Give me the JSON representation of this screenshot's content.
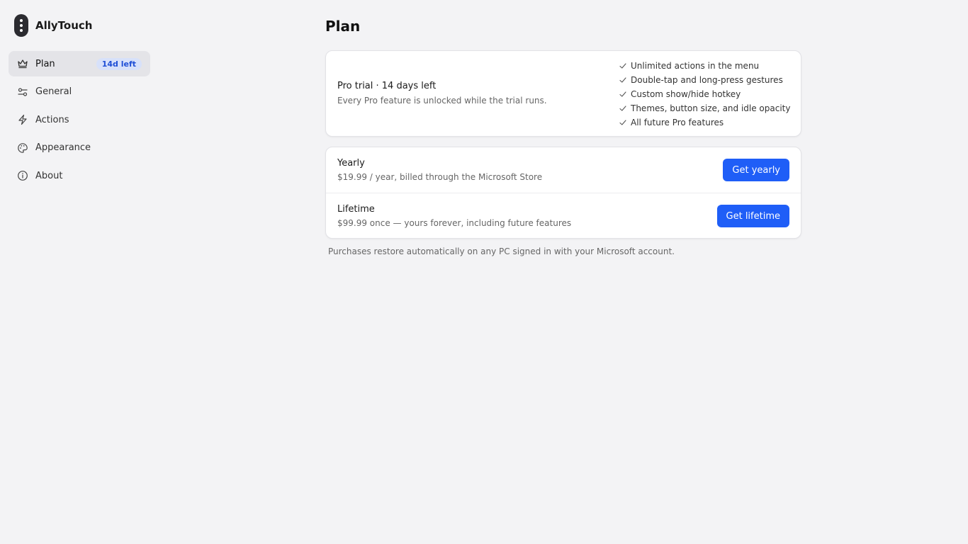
{
  "app": {
    "name": "AllyTouch"
  },
  "sidebar": {
    "items": [
      {
        "label": "Plan",
        "icon": "crown-icon",
        "active": true,
        "badge": "14d left"
      },
      {
        "label": "General",
        "icon": "sliders-icon"
      },
      {
        "label": "Actions",
        "icon": "lightning-icon"
      },
      {
        "label": "Appearance",
        "icon": "palette-icon"
      },
      {
        "label": "About",
        "icon": "info-icon"
      }
    ]
  },
  "main": {
    "title": "Plan",
    "trial": {
      "title": "Pro trial · 14 days left",
      "subtitle": "Every Pro feature is unlocked while the trial runs.",
      "features": [
        "Unlimited actions in the menu",
        "Double-tap and long-press gestures",
        "Custom show/hide hotkey",
        "Themes, button size, and idle opacity",
        "All future Pro features"
      ]
    },
    "plans": [
      {
        "name": "Yearly",
        "price": "$19.99 / year, billed through the Microsoft Store",
        "button": "Get yearly"
      },
      {
        "name": "Lifetime",
        "price": "$99.99 once — yours forever, including future features",
        "button": "Get lifetime"
      }
    ],
    "footnote": "Purchases restore automatically on any PC signed in with your Microsoft account."
  },
  "colors": {
    "accent": "#1f5ef7",
    "badge_bg": "#d7e1fa",
    "badge_text": "#1f4fd6",
    "background": "#f3f3f5"
  }
}
